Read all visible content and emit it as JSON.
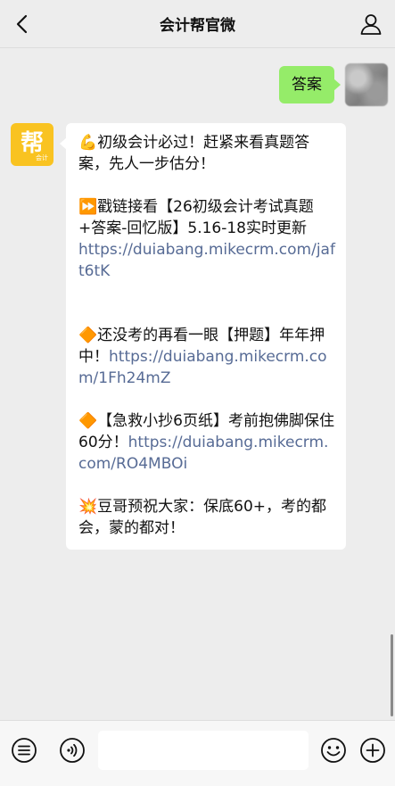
{
  "header": {
    "title": "会计帮官微",
    "back_icon": "chevron-left-icon",
    "profile_icon": "person-icon"
  },
  "messages": {
    "outgoing": {
      "text": "答案"
    },
    "incoming": {
      "avatar_char": "帮",
      "avatar_sub": "会计",
      "p1_emoji": "💪",
      "p1_text": "初级会计必过！赶紧来看真题答案，先人一步估分！",
      "p2_emoji": "⏩",
      "p2_text": "戳链接看【26初级会计考试真题+答案-回忆版】5.16-18实时更新",
      "p2_link": "https://duiabang.mikecrm.com/jaft6tK",
      "p3_emoji": "🔶",
      "p3_text": "还没考的再看一眼【押题】年年押中！",
      "p3_link": "https://duiabang.mikecrm.com/1Fh24mZ",
      "p4_emoji": "🔶",
      "p4_text": "【急救小抄6页纸】考前抱佛脚保住60分！",
      "p4_link": "https://duiabang.mikecrm.com/RO4MBOi",
      "p5_emoji": "💥",
      "p5_text": "豆哥预祝大家：保底60+，考的都会，蒙的都对！"
    }
  },
  "bottombar": {
    "menu_icon": "menu-list-icon",
    "voice_icon": "voice-icon",
    "emoji_icon": "emoji-icon",
    "plus_icon": "plus-icon"
  },
  "colors": {
    "background": "#ededed",
    "outgoing_bubble": "#95ec69",
    "incoming_bubble": "#ffffff",
    "link": "#576b95",
    "brand_avatar": "#f9c321"
  }
}
